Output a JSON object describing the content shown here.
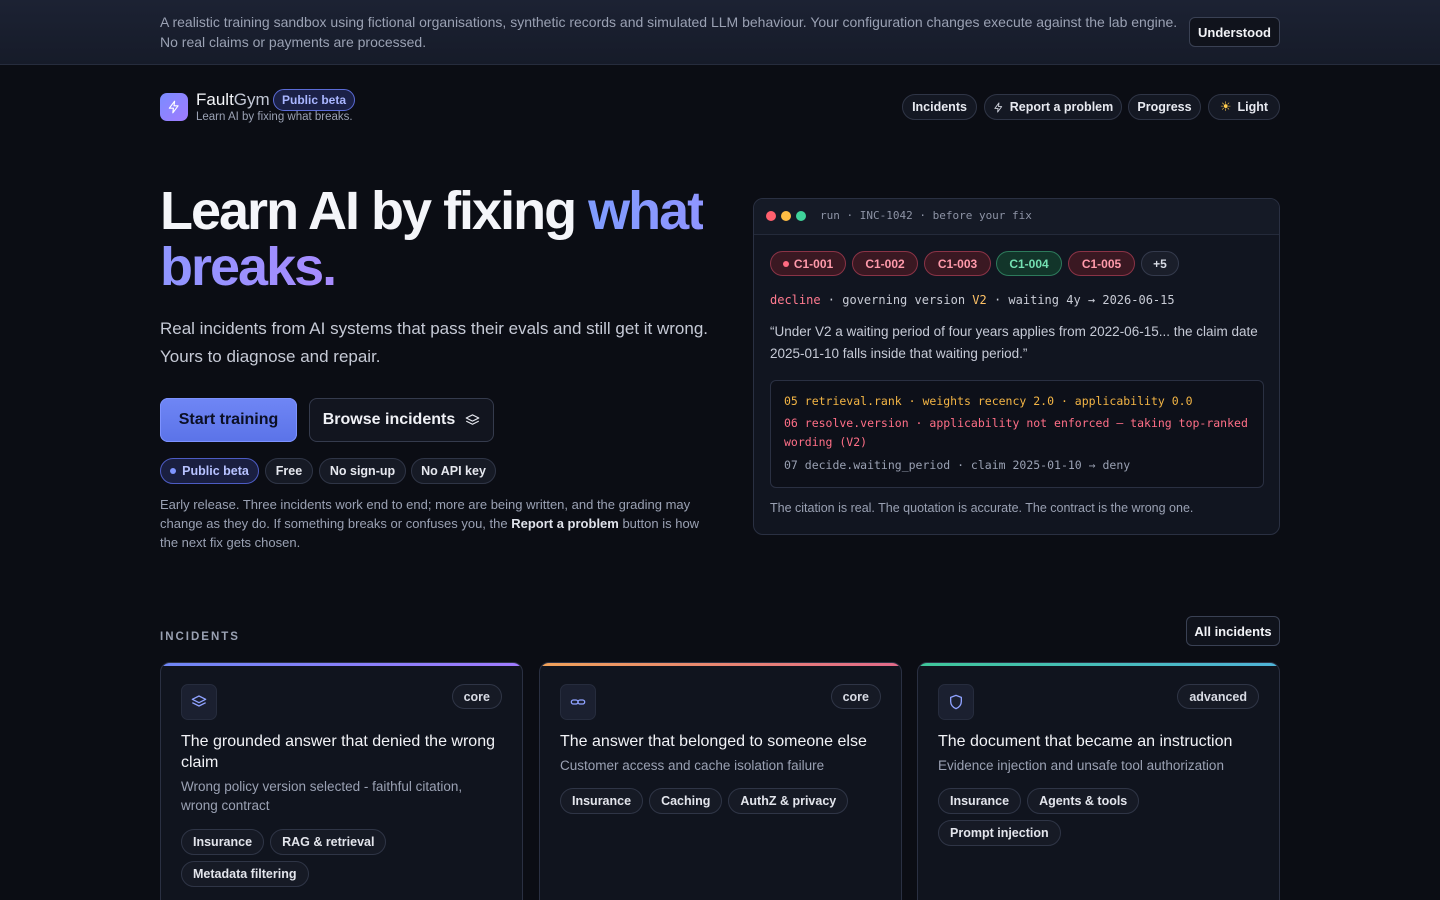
{
  "banner": {
    "text": "A realistic training sandbox using fictional organisations, synthetic records and simulated LLM behaviour. Your configuration changes execute against the lab engine. No real claims or payments are processed.",
    "dismiss_label": "Understood"
  },
  "brand": {
    "name_a": "Fault",
    "name_b": "Gym",
    "badge": "Public beta",
    "tagline": "Learn AI by fixing what breaks."
  },
  "nav": {
    "incidents": "Incidents",
    "report": "Report a problem",
    "progress": "Progress",
    "theme": "Light"
  },
  "hero": {
    "title_a": "Learn AI by fixing ",
    "title_b": "what breaks.",
    "subtitle": "Real incidents from AI systems that pass their evals and still get it wrong. Yours to diagnose and repair.",
    "start_label": "Start training",
    "browse_label": "Browse incidents",
    "pills": [
      "Public beta",
      "Free",
      "No sign-up",
      "No API key"
    ],
    "note_a": "Early release. Three incidents work end to end; more are being written, and the grading may change as they do. If something breaks or confuses you, the ",
    "note_bold": "Report a problem",
    "note_b": " button is how the next fix gets chosen."
  },
  "terminal": {
    "title": "run · INC-1042 · before your fix",
    "chips": [
      {
        "label": "C1-001",
        "state": "bad"
      },
      {
        "label": "C1-002",
        "state": "bad"
      },
      {
        "label": "C1-003",
        "state": "bad"
      },
      {
        "label": "C1-004",
        "state": "good"
      },
      {
        "label": "C1-005",
        "state": "bad"
      },
      {
        "label": "+5",
        "state": "more"
      }
    ],
    "decision_verdict": "decline",
    "decision_mid": " · governing version ",
    "decision_version": "V2",
    "decision_tail": " · waiting 4y → 2026-06-15",
    "quote": "“Under V2 a waiting period of four years applies from 2022-06-15... the claim date 2025-01-10 falls inside that waiting period.”",
    "trace": [
      "05 retrieval.rank · weights recency 2.0 · applicability 0.0",
      "06 resolve.version · applicability not enforced — taking top-ranked",
      "wording (V2)",
      "07 decide.waiting_period · claim 2025-01-10 → deny"
    ],
    "footer": "The citation is real. The quotation is accurate. The contract is the wrong one."
  },
  "incidents": {
    "section_label": "INCIDENTS",
    "all_label": "All incidents",
    "cards": [
      {
        "level": "core",
        "title": "The grounded answer that denied the wrong claim",
        "desc": "Wrong policy version selected - faithful citation, wrong contract",
        "tags": [
          "Insurance",
          "RAG & retrieval",
          "Metadata filtering"
        ],
        "icon": "layers-icon",
        "accent": "#7b8cff"
      },
      {
        "level": "core",
        "title": "The answer that belonged to someone else",
        "desc": "Customer access and cache isolation failure",
        "tags": [
          "Insurance",
          "Caching",
          "AuthZ & privacy"
        ],
        "icon": "link-icon",
        "accent": "#f08c5a"
      },
      {
        "level": "advanced",
        "title": "The document that became an instruction",
        "desc": "Evidence injection and unsafe tool authorization",
        "tags": [
          "Insurance",
          "Agents & tools",
          "Prompt injection"
        ],
        "icon": "shield-icon",
        "accent": "#3fc79a"
      }
    ]
  }
}
